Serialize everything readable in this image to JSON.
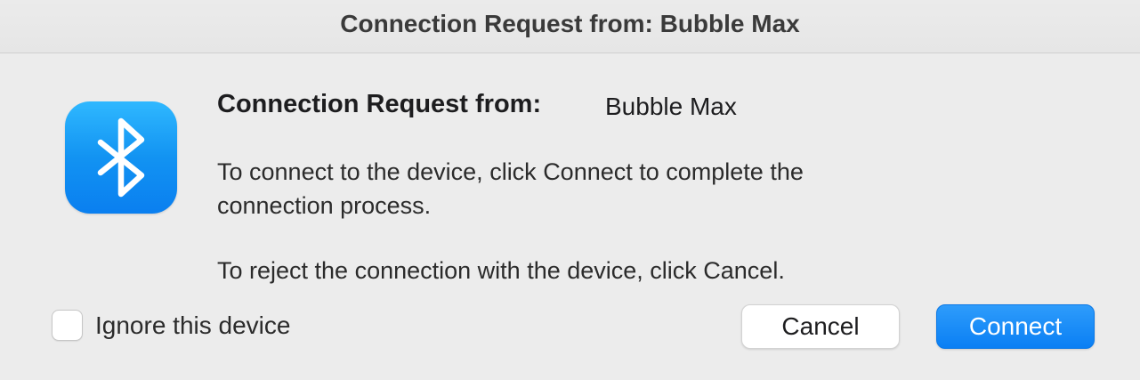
{
  "window": {
    "title": "Connection Request from: Bubble Max"
  },
  "dialog": {
    "icon": "bluetooth-icon",
    "heading_label": "Connection Request from:",
    "device_name": "Bubble Max",
    "message_connect_line1": "To connect to the device, click Connect to complete the",
    "message_connect_line2": "connection process.",
    "message_reject": "To reject the connection with the device, click Cancel."
  },
  "options": {
    "ignore_label": "Ignore this device",
    "ignore_checked": false
  },
  "buttons": {
    "cancel_label": "Cancel",
    "connect_label": "Connect"
  },
  "colors": {
    "accent": "#0a7ff4",
    "icon_gradient_top": "#2fb8ff",
    "icon_gradient_bottom": "#0a7ff0",
    "background": "#ececec"
  }
}
